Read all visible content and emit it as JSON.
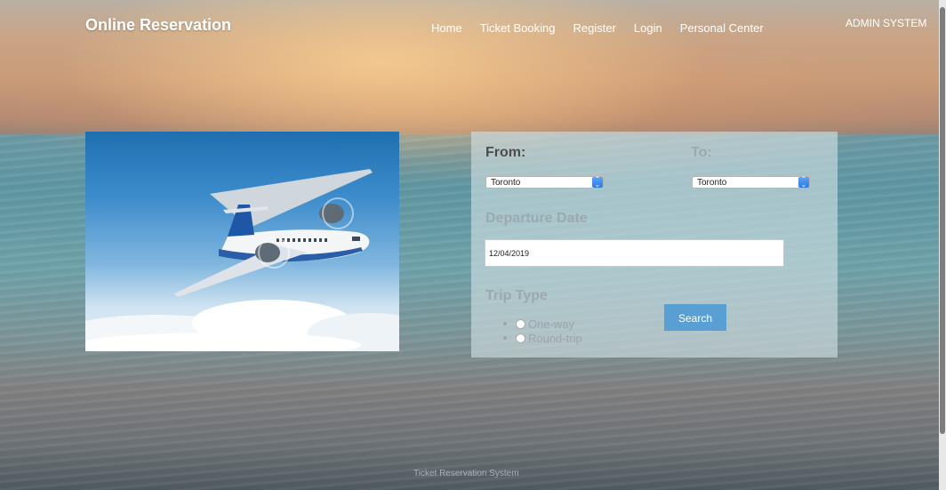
{
  "header": {
    "brand": "Online Reservation",
    "nav": [
      "Home",
      "Ticket Booking",
      "Register",
      "Login",
      "Personal Center"
    ],
    "admin": "ADMIN SYSTEM"
  },
  "form": {
    "from_label": "From:",
    "to_label": "To:",
    "from_value": "Toronto",
    "to_value": "Toronto",
    "departure_label": "Departure Date",
    "departure_value": "12/04/2019",
    "trip_type_label": "Trip Type",
    "trip_options": [
      "One-way",
      "Round-trip"
    ],
    "search_label": "Search"
  },
  "footer": {
    "text": "Ticket Reservation System"
  },
  "icons": {
    "select_arrow": "updown-chevron-icon",
    "photo": "airplane-photo"
  }
}
